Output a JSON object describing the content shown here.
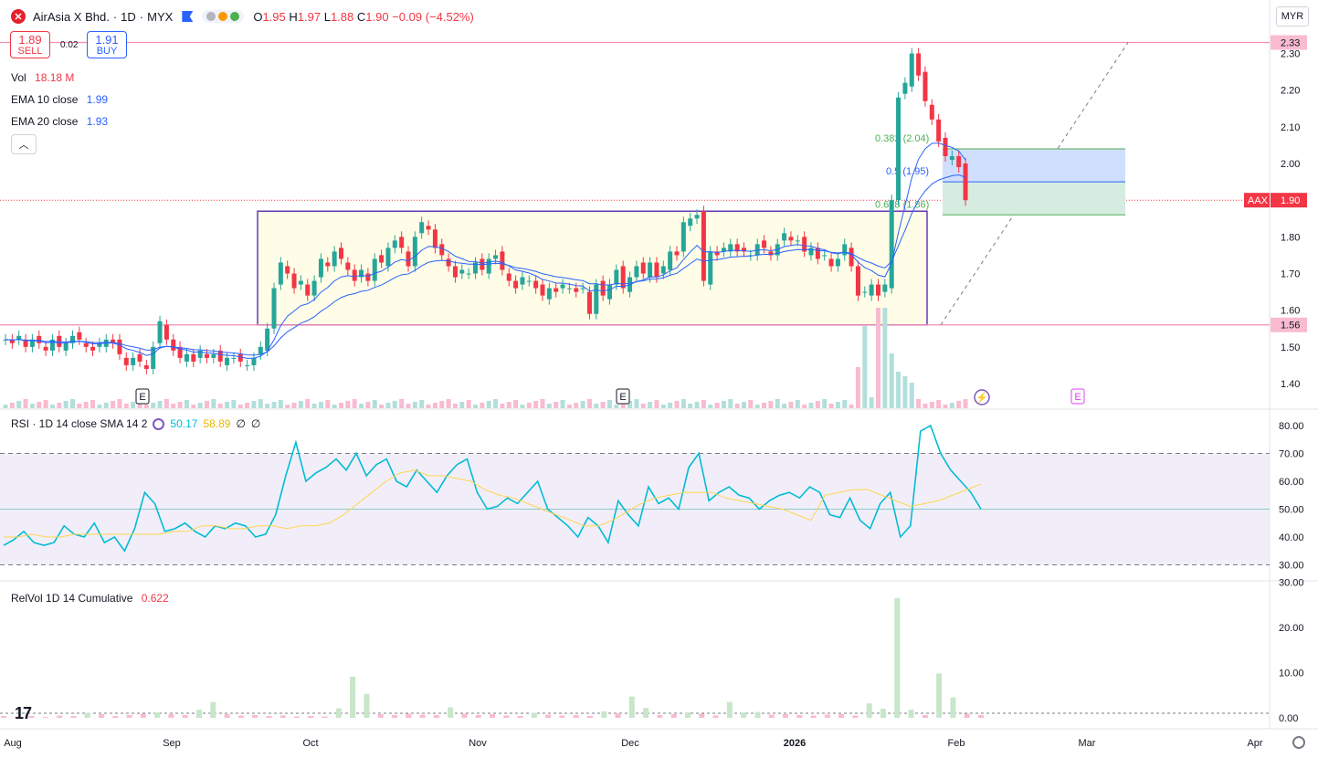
{
  "header": {
    "symbol": "AirAsia X Bhd.",
    "sep1": "·",
    "interval": "1D",
    "sep2": "·",
    "exchange": "MYX",
    "open_label": "O",
    "open": "1.95",
    "high_label": "H",
    "high": "1.97",
    "low_label": "L",
    "low": "1.88",
    "close_label": "C",
    "close": "1.90",
    "change": "−0.09 (−4.52%)"
  },
  "trade": {
    "sell_price": "1.89",
    "sell_label": "SELL",
    "spread": "0.02",
    "buy_price": "1.91",
    "buy_label": "BUY"
  },
  "legend": {
    "vol_label": "Vol",
    "vol_value": "18.18 M",
    "ema10_label": "EMA 10 close",
    "ema10_value": "1.99",
    "ema20_label": "EMA 20 close",
    "ema20_value": "1.93"
  },
  "currency": "MYR",
  "rsi": {
    "label": "RSI · 1D 14 close SMA 14 2",
    "value1": "50.17",
    "value2": "58.89",
    "value3": "∅",
    "value4": "∅"
  },
  "relvol": {
    "label": "RelVol 1D 14 Cumulative",
    "value": "0.622"
  },
  "price_axis": [
    "2.30",
    "2.20",
    "2.10",
    "2.00",
    "1.90",
    "1.80",
    "1.70",
    "1.60",
    "1.50",
    "1.40"
  ],
  "price_tags": {
    "top": "2.33",
    "bottom": "1.56",
    "symbol": "AAX",
    "last": "1.90"
  },
  "rsi_axis": [
    "80.00",
    "70.00",
    "60.00",
    "50.00",
    "40.00",
    "30.00"
  ],
  "relvol_axis": [
    "30.00",
    "20.00",
    "10.00",
    "0.00"
  ],
  "time_axis": [
    "Aug",
    "Sep",
    "Oct",
    "Nov",
    "Dec",
    "2026",
    "Feb",
    "Mar",
    "Apr"
  ],
  "fib": {
    "f382": "0.382 (2.04)",
    "f5": "0.5 (1.95)",
    "f618": "0.618 (1.86)"
  },
  "earnings_marker": "E",
  "colors": {
    "up": "#26a69a",
    "down": "#f23645",
    "ema10": "#2962ff",
    "ema20": "#2962ff",
    "rsi": "#00bcd4",
    "rsi_ma": "#ffd54f",
    "box": "#673ab7",
    "hline": "#f48fb1"
  },
  "chart_data": {
    "type": "candlestick",
    "closes": [
      1.52,
      1.51,
      1.53,
      1.5,
      1.52,
      1.51,
      1.49,
      1.52,
      1.5,
      1.51,
      1.53,
      1.52,
      1.5,
      1.49,
      1.51,
      1.52,
      1.51,
      1.48,
      1.45,
      1.47,
      1.46,
      1.44,
      1.5,
      1.57,
      1.52,
      1.49,
      1.47,
      1.48,
      1.46,
      1.49,
      1.47,
      1.48,
      1.46,
      1.47,
      1.47,
      1.46,
      1.45,
      1.47,
      1.5,
      1.55,
      1.66,
      1.73,
      1.7,
      1.66,
      1.68,
      1.64,
      1.68,
      1.74,
      1.72,
      1.76,
      1.74,
      1.71,
      1.68,
      1.71,
      1.68,
      1.74,
      1.73,
      1.77,
      1.79,
      1.77,
      1.72,
      1.8,
      1.84,
      1.82,
      1.77,
      1.75,
      1.72,
      1.69,
      1.71,
      1.7,
      1.73,
      1.71,
      1.74,
      1.75,
      1.71,
      1.68,
      1.66,
      1.69,
      1.68,
      1.66,
      1.64,
      1.66,
      1.65,
      1.67,
      1.66,
      1.65,
      1.66,
      1.59,
      1.67,
      1.64,
      1.67,
      1.71,
      1.66,
      1.69,
      1.72,
      1.7,
      1.73,
      1.69,
      1.72,
      1.76,
      1.75,
      1.84,
      1.85,
      1.86,
      1.68,
      1.76,
      1.75,
      1.77,
      1.78,
      1.76,
      1.76,
      1.75,
      1.78,
      1.77,
      1.75,
      1.78,
      1.81,
      1.79,
      1.79,
      1.76,
      1.77,
      1.74,
      1.75,
      1.72,
      1.74,
      1.78,
      1.72,
      1.64,
      1.65,
      1.67,
      1.64,
      1.67,
      1.9,
      2.18,
      2.22,
      2.3,
      2.24,
      2.17,
      2.12,
      2.06,
      2.02,
      2.02,
      1.99,
      1.9
    ],
    "volume_peak_index": 129,
    "rsi": [
      37,
      39,
      42,
      38,
      37,
      38,
      44,
      41,
      40,
      45,
      38,
      40,
      35,
      43,
      56,
      52,
      42,
      43,
      45,
      42,
      40,
      44,
      43,
      45,
      44,
      40,
      41,
      48,
      62,
      74,
      60,
      63,
      65,
      68,
      64,
      70,
      62,
      66,
      68,
      60,
      58,
      64,
      60,
      56,
      62,
      66,
      68,
      56,
      50,
      51,
      54,
      52,
      56,
      60,
      50,
      47,
      44,
      40,
      47,
      44,
      38,
      53,
      48,
      44,
      58,
      52,
      54,
      50,
      65,
      70,
      53,
      56,
      58,
      55,
      54,
      50,
      53,
      55,
      56,
      54,
      58,
      56,
      48,
      47,
      54,
      46,
      43,
      52,
      56,
      40,
      44,
      78,
      80,
      70,
      64,
      60,
      56,
      50
    ],
    "rsi_ma": [
      40,
      40,
      41,
      40,
      40,
      41,
      41,
      41,
      41,
      41,
      41,
      41,
      42,
      42,
      44,
      44,
      43,
      43,
      44,
      44,
      43,
      44,
      44,
      45,
      48,
      52,
      56,
      60,
      63,
      64,
      62,
      62,
      61,
      60,
      57,
      55,
      54,
      52,
      50,
      48,
      46,
      44,
      44,
      46,
      49,
      52,
      54,
      55,
      56,
      56,
      56,
      54,
      53,
      52,
      51,
      50,
      48,
      46,
      55,
      56,
      57,
      57,
      55,
      53,
      51,
      52,
      53,
      55,
      57,
      59
    ],
    "relvol": [
      0.4,
      0.3,
      0.4,
      0.2,
      0.5,
      0.4,
      1.1,
      0.8,
      0.4,
      0.6,
      0.9,
      1.2,
      0.8,
      0.6,
      1.8,
      3.5,
      0.8,
      0.5,
      0.6,
      0.4,
      0.5,
      0.3,
      0.4,
      0.3,
      2.1,
      9.1,
      5.3,
      0.8,
      0.6,
      0.9,
      0.7,
      0.6,
      2.3,
      0.9,
      0.6,
      0.8,
      0.5,
      0.4,
      1.1,
      0.7,
      0.5,
      0.6,
      0.4,
      1.4,
      1.0,
      4.7,
      2.2,
      0.6,
      0.8,
      1.2,
      0.9,
      0.5,
      3.5,
      1.2,
      1.3,
      0.7,
      0.8,
      0.6,
      0.5,
      0.7,
      0.8,
      0.5,
      3.2,
      2.0,
      26.5,
      1.8,
      0.6,
      9.8,
      4.5,
      0.9,
      0.6
    ]
  }
}
